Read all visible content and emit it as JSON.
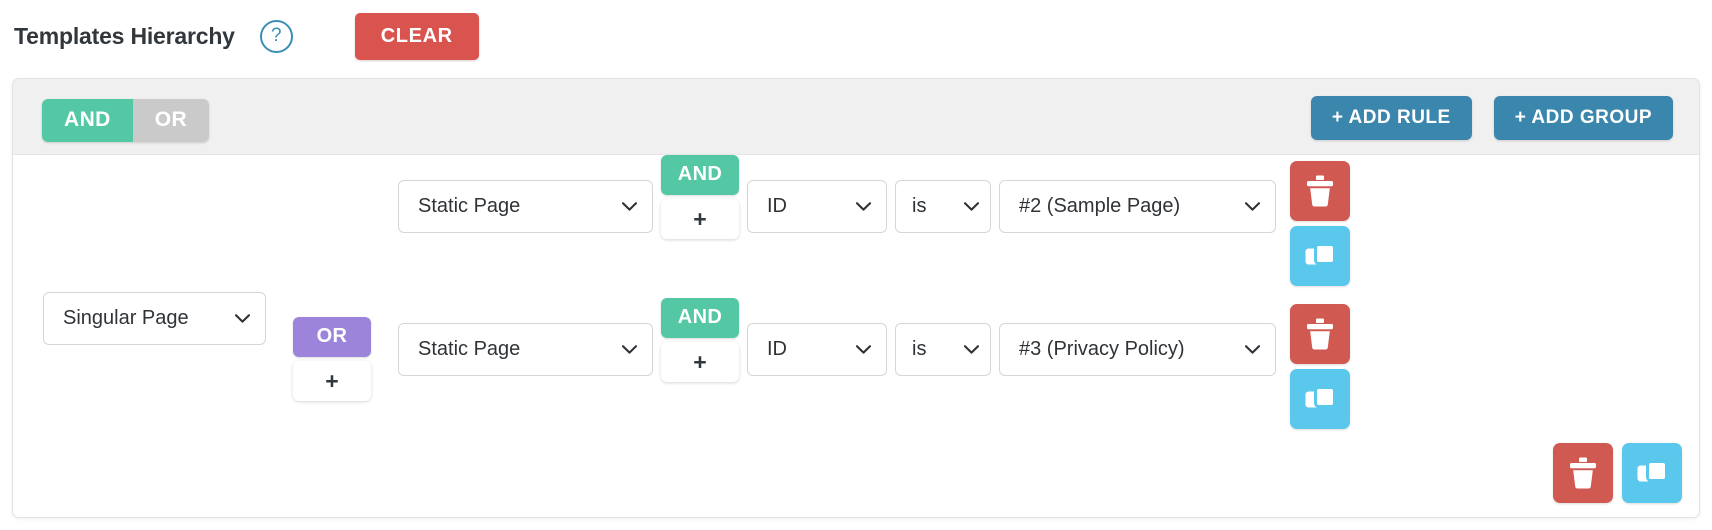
{
  "header": {
    "title": "Templates Hierarchy",
    "help_icon": "question-circle-icon",
    "clear_label": "CLEAR"
  },
  "group": {
    "conjunction": {
      "options": [
        "AND",
        "OR"
      ],
      "selected": "AND",
      "and_label": "AND",
      "or_label": "OR"
    },
    "actions": {
      "add_rule_label": "+ ADD RULE",
      "add_group_label": "+ ADD GROUP"
    },
    "subject": {
      "label": "Singular Page",
      "caret": "chevron-down-icon"
    },
    "subject_conjunction": {
      "label": "OR",
      "plus_label": "+"
    },
    "rules": [
      {
        "conjunction": {
          "label": "AND",
          "plus_label": "+"
        },
        "entity": "Static Page",
        "field": "ID",
        "operator": "is",
        "value": "#2 (Sample Page)",
        "delete_icon": "trash-icon",
        "copy_icon": "copy-icon"
      },
      {
        "conjunction": {
          "label": "AND",
          "plus_label": "+"
        },
        "entity": "Static Page",
        "field": "ID",
        "operator": "is",
        "value": "#3 (Privacy Policy)",
        "delete_icon": "trash-icon",
        "copy_icon": "copy-icon"
      }
    ],
    "group_delete_icon": "trash-icon",
    "group_copy_icon": "copy-icon"
  },
  "colors": {
    "green": "#54c8a4",
    "purple": "#9b84d9",
    "blue": "#3a86ad",
    "red": "#d9534f",
    "icon_red": "#d05a52",
    "icon_blue": "#5ac8ed",
    "grey": "#cacaca"
  }
}
